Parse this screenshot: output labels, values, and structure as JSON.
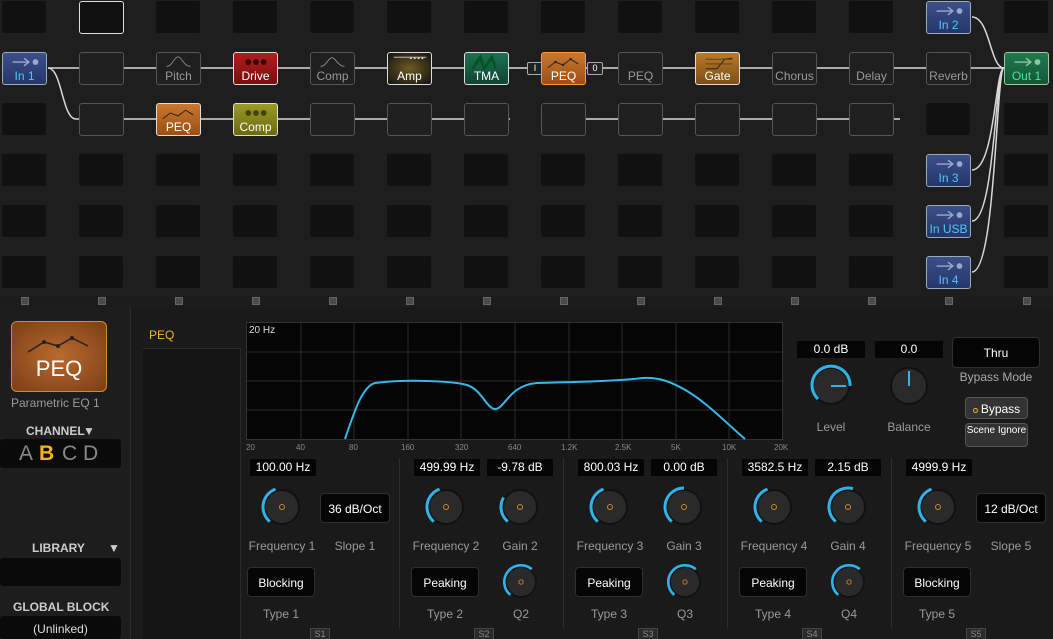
{
  "grid": {
    "blocks": [
      {
        "name": "input-1-block",
        "label": "In 1",
        "type": "io",
        "icon": "input-arrow-icon"
      },
      {
        "name": "input-2-block",
        "label": "In 2",
        "type": "io",
        "icon": "input-arrow-icon"
      },
      {
        "name": "pitch-block",
        "label": "Pitch",
        "type": "empty"
      },
      {
        "name": "drive-block",
        "label": "Drive",
        "type": "fx",
        "icon": "drive-icon"
      },
      {
        "name": "comp-block-row1",
        "label": "Comp",
        "type": "empty"
      },
      {
        "name": "amp-block",
        "label": "Amp",
        "type": "fx",
        "icon": "amp-icon"
      },
      {
        "name": "tma-block",
        "label": "TMA",
        "type": "fx",
        "icon": "tma-icon"
      },
      {
        "name": "peq-block-active",
        "label": "PEQ",
        "type": "fx",
        "icon": "peq-icon"
      },
      {
        "name": "peq-block-row1b",
        "label": "PEQ",
        "type": "empty"
      },
      {
        "name": "gate-block",
        "label": "Gate",
        "type": "fx",
        "icon": "gate-icon"
      },
      {
        "name": "chorus-block",
        "label": "Chorus",
        "type": "empty"
      },
      {
        "name": "delay-block",
        "label": "Delay",
        "type": "empty"
      },
      {
        "name": "reverb-block",
        "label": "Reverb",
        "type": "empty"
      },
      {
        "name": "output-1-block",
        "label": "Out 1",
        "type": "out",
        "icon": "output-arrow-icon"
      },
      {
        "name": "peq-block-row2",
        "label": "PEQ",
        "type": "fx",
        "icon": "peq-icon"
      },
      {
        "name": "comp-block-row2",
        "label": "Comp",
        "type": "fx",
        "icon": "comp-icon"
      },
      {
        "name": "input-3-block",
        "label": "In 3",
        "type": "io",
        "icon": "input-arrow-icon"
      },
      {
        "name": "input-usb-block",
        "label": "In USB",
        "type": "io",
        "icon": "input-arrow-icon"
      },
      {
        "name": "input-4-block",
        "label": "In 4",
        "type": "io",
        "icon": "input-arrow-icon"
      }
    ],
    "mix_left": "I",
    "mix_right": "0"
  },
  "left": {
    "block_title": "PEQ",
    "block_subtitle": "Parametric EQ 1",
    "channel_label": "CHANNEL",
    "channels": [
      "A",
      "B",
      "C",
      "D"
    ],
    "active_channel": "B",
    "library_label": "LIBRARY",
    "global_block_label": "GLOBAL BLOCK",
    "global_block_value": "(Unlinked)"
  },
  "tab": {
    "label": "PEQ"
  },
  "graph": {
    "top_label": "20 Hz",
    "x_ticks": [
      "20",
      "40",
      "80",
      "160",
      "320",
      "640",
      "1.2K",
      "2.5K",
      "5K",
      "10K",
      "20K"
    ],
    "curve_color": "#36b8e8"
  },
  "mix": {
    "level_value": "0.0 dB",
    "level_label": "Level",
    "balance_value": "0.0",
    "balance_label": "Balance",
    "bypass_mode_value": "Thru",
    "bypass_mode_label": "Bypass Mode",
    "bypass_label": "Bypass",
    "scene_ignore_label": "Scene Ignore"
  },
  "bands": [
    {
      "freq_value": "100.00 Hz",
      "freq_label": "Frequency 1",
      "second_value": "36 dB/Oct",
      "second_label": "Slope 1",
      "type_value": "Blocking",
      "type_label": "Type 1",
      "s_label": "S1"
    },
    {
      "freq_value": "499.99 Hz",
      "freq_label": "Frequency 2",
      "second_value": "-9.78 dB",
      "second_label": "Gain 2",
      "type_value": "Peaking",
      "type_label": "Type 2",
      "q_label": "Q2",
      "s_label": "S2"
    },
    {
      "freq_value": "800.03 Hz",
      "freq_label": "Frequency 3",
      "second_value": "0.00 dB",
      "second_label": "Gain 3",
      "type_value": "Peaking",
      "type_label": "Type 3",
      "q_label": "Q3",
      "s_label": "S3"
    },
    {
      "freq_value": "3582.5 Hz",
      "freq_label": "Frequency 4",
      "second_value": "2.15 dB",
      "second_label": "Gain 4",
      "type_value": "Peaking",
      "type_label": "Type 4",
      "q_label": "Q4",
      "s_label": "S4"
    },
    {
      "freq_value": "4999.9 Hz",
      "freq_label": "Frequency 5",
      "second_value": "12 dB/Oct",
      "second_label": "Slope 5",
      "type_value": "Blocking",
      "type_label": "Type 5",
      "s_label": "S5"
    }
  ]
}
